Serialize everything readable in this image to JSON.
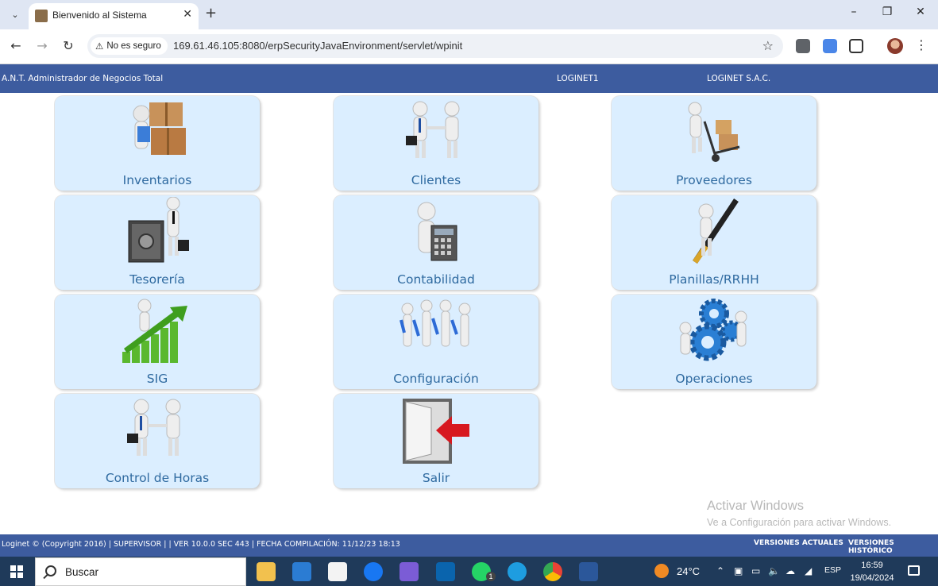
{
  "browser": {
    "tab_title": "Bienvenido al Sistema",
    "security_label": "No es seguro",
    "url": "169.61.46.105:8080/erpSecurityJavaEnvironment/servlet/wpinit"
  },
  "header": {
    "app_name": "A.N.T. Administrador de Negocios Total",
    "user": "LOGINET1",
    "company": "LOGINET S.A.C."
  },
  "tiles": [
    {
      "label": "Inventarios",
      "icon": "boxes-icon"
    },
    {
      "label": "Clientes",
      "icon": "handshake-icon"
    },
    {
      "label": "Proveedores",
      "icon": "hand-truck-icon"
    },
    {
      "label": "Tesorería",
      "icon": "safe-icon"
    },
    {
      "label": "Contabilidad",
      "icon": "calculator-icon"
    },
    {
      "label": "Planillas/RRHH",
      "icon": "pen-icon"
    },
    {
      "label": "SIG",
      "icon": "growth-chart-icon"
    },
    {
      "label": "Configuración",
      "icon": "tools-team-icon"
    },
    {
      "label": "Operaciones",
      "icon": "gears-icon"
    },
    {
      "label": "Control de Horas",
      "icon": "handshake-icon"
    },
    {
      "label": "Salir",
      "icon": "exit-door-icon"
    }
  ],
  "watermark": {
    "title": "Activar Windows",
    "subtitle": "Ve a Configuración para activar Windows."
  },
  "footer": {
    "text": "Loginet © (Copyright 2016) | SUPERVISOR | | VER 10.0.0 SEC 443 | FECHA COMPILACIÓN: 11/12/23 18:13",
    "btn_current": "VERSIONES ACTUALES",
    "btn_history": "VERSIONES HISTÓRICO"
  },
  "taskbar": {
    "search_placeholder": "Buscar",
    "weather": "24°C",
    "language": "ESP",
    "time": "16:59",
    "date": "19/04/2024",
    "whatsapp_badge": "1"
  },
  "colors": {
    "header_bg": "#3d5c9f",
    "tile_bg": "#dbeeff",
    "tile_text": "#2f6aa0"
  }
}
